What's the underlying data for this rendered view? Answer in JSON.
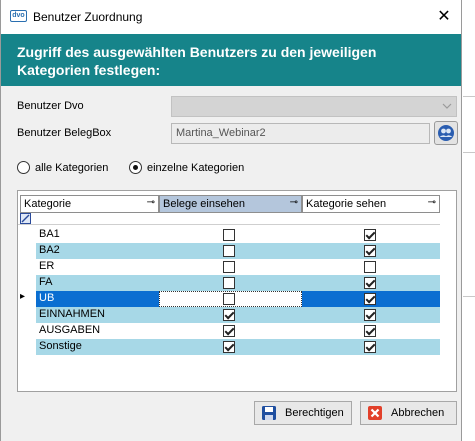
{
  "window": {
    "title": "Benutzer Zuordnung",
    "app_icon_text": "dvo",
    "close_glyph": "✕"
  },
  "header": {
    "text": "Zugriff des ausgewählten Benutzers zu den jeweiligen Kategorien festlegen:",
    "color": "#16848a"
  },
  "form": {
    "benutzer_dvo_label": "Benutzer Dvo",
    "benutzer_dvo_value": "",
    "benutzer_belegbox_label": "Benutzer BelegBox",
    "benutzer_belegbox_value": "Martina_Webinar2"
  },
  "radios": {
    "all_label": "alle Kategorien",
    "single_label": "einzelne Kategorien",
    "selected": "single"
  },
  "grid": {
    "columns": [
      "Kategorie",
      "Belege einsehen",
      "Kategorie sehen"
    ],
    "rows": [
      {
        "kategorie": "BA1",
        "belege": false,
        "sehen": true
      },
      {
        "kategorie": "BA2",
        "belege": false,
        "sehen": true
      },
      {
        "kategorie": "ER",
        "belege": false,
        "sehen": false
      },
      {
        "kategorie": "FA",
        "belege": false,
        "sehen": true
      },
      {
        "kategorie": "UB",
        "belege": false,
        "sehen": true
      },
      {
        "kategorie": "EINNAHMEN",
        "belege": true,
        "sehen": true
      },
      {
        "kategorie": "AUSGABEN",
        "belege": true,
        "sehen": true
      },
      {
        "kategorie": "Sonstige",
        "belege": true,
        "sehen": true
      }
    ],
    "selected_row": 4,
    "alt_row_color": "#a7d8e7",
    "selected_color": "#0a6ed1"
  },
  "buttons": {
    "berechtigen": "Berechtigen",
    "abbrechen": "Abbrechen"
  }
}
